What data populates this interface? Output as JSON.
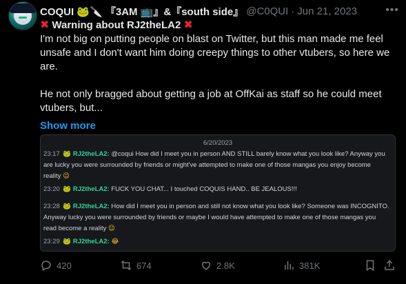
{
  "author": {
    "display_name": "COQUI 🐸🔪 『3AM 📺』&『south side』",
    "handle": "@C0QUI",
    "separator": "·",
    "date": "Jun 21, 2023"
  },
  "tweet": {
    "title": "Warning about RJ2theLA2",
    "paragraph1": "I'm not big on putting people on blast on Twitter, but this man made me feel unsafe and I don't want him doing creepy things to other vtubers, so here we are.",
    "paragraph2": "He not only bragged about getting a job at OffKai as staff so he could meet vtubers, but...",
    "show_more": "Show more"
  },
  "quote_image": {
    "date": "6/20/2023",
    "messages": [
      {
        "time": "23:17",
        "user": "RJ2theLA2:",
        "text": "@coqui How did I meet you in person AND STILL barely know what you look like? Anyway you are lucky you were surrounded by friends or might've attempted to make one of those mangas you enjoy become reality",
        "emoji": "😉"
      },
      {
        "time": "23:20",
        "user": "RJ2theLA2:",
        "text": "FUCK YOU CHAT... I touched COQUIS HAND.. BE JEALOUS!!!",
        "emoji": ""
      },
      {
        "time": "23:28",
        "user": "RJ2theLA2:",
        "text": "How did I meet you in person and still not know what you look like? Someone was INCOGNITO. Anyway lucky you were surrounded by friends or maybe I would have attempted to make one of those mangas you read become a reality",
        "emoji": "😉"
      },
      {
        "time": "23:29",
        "user": "RJ2theLA2:",
        "text": "",
        "emoji": "😂"
      }
    ]
  },
  "actions": {
    "replies": "420",
    "reposts": "674",
    "likes": "2.8K",
    "views": "381K"
  },
  "icons": [
    "more-icon",
    "x-mark-icon",
    "frog-icon",
    "reply-icon",
    "repost-icon",
    "like-icon",
    "views-icon",
    "bookmark-icon",
    "share-icon"
  ],
  "colors": {
    "background": "#000000",
    "text": "#e7e9ea",
    "muted": "#71767b",
    "link": "#1d9bf0",
    "danger": "#f4212e"
  }
}
